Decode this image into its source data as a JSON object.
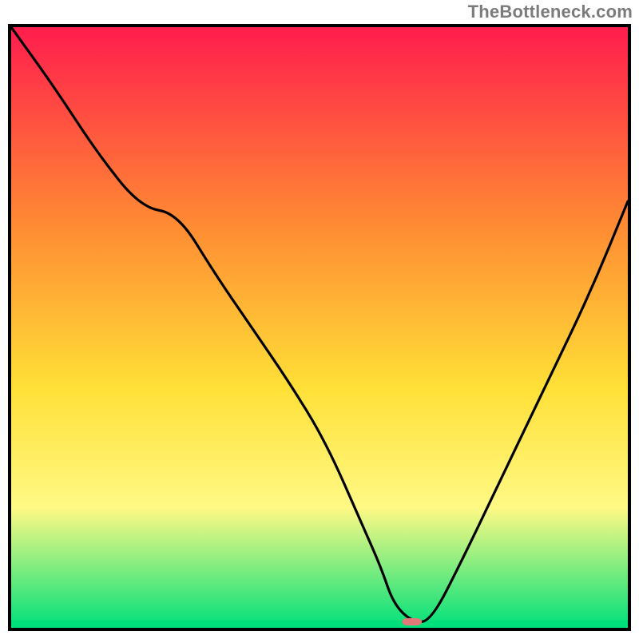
{
  "watermark": "TheBottleneck.com",
  "chart_data": {
    "type": "line",
    "title": "",
    "xlabel": "",
    "ylabel": "",
    "xlim": [
      0,
      100
    ],
    "ylim": [
      0,
      100
    ],
    "note": "Axes are unlabeled; values below are estimated positions in percent of plot area (0 = left/bottom, 100 = right/top). The curve depicts a bottleneck metric that drops to a minimum around x≈65 and rises again.",
    "background_gradient": {
      "plot_area_stops": [
        {
          "offset": 0,
          "color": "#ff1d4d"
        },
        {
          "offset": 33,
          "color": "#ff8b33"
        },
        {
          "offset": 60,
          "color": "#ffe037"
        },
        {
          "offset": 80,
          "color": "#fff985"
        },
        {
          "offset": 100,
          "color": "#00e07a"
        }
      ],
      "green_band_y_percent": 1.2
    },
    "series": [
      {
        "name": "bottleneck-curve",
        "x": [
          0,
          7,
          14,
          21,
          27,
          33,
          39,
          45,
          51,
          57,
          60,
          62,
          65,
          68,
          73,
          80,
          87,
          94,
          100
        ],
        "y": [
          100,
          90,
          79,
          70,
          69,
          59,
          50,
          41,
          31,
          17,
          10,
          4,
          1,
          1,
          11,
          26,
          41,
          56,
          71
        ]
      }
    ],
    "marker": {
      "x_percent": 65,
      "y_percent": 1,
      "width_percent": 3.2,
      "height_percent": 1.2,
      "color": "#e17a78"
    },
    "frame_color": "#000000"
  }
}
